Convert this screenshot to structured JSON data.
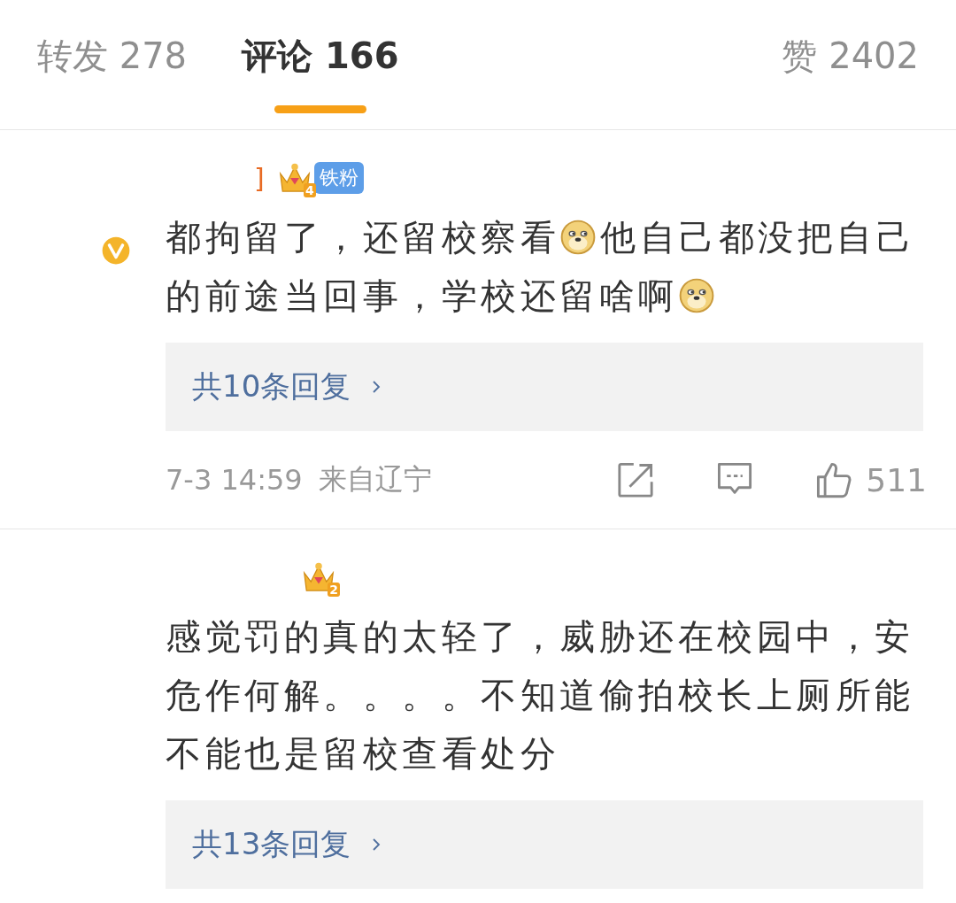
{
  "tabs": [
    {
      "label": "转发 278",
      "selected": false
    },
    {
      "label": "评论 166",
      "selected": true
    },
    {
      "label": "赞 2402",
      "selected": false
    }
  ],
  "comments": [
    {
      "name": "]",
      "verified": true,
      "crown_level": "4",
      "fan_badge": "铁粉",
      "lines": [
        [
          {
            "kind": "text",
            "text": "都拘留了，还留校察看"
          },
          {
            "kind": "emoji"
          },
          {
            "kind": "text",
            "text": "他自己都没把自己"
          }
        ],
        [
          {
            "kind": "text",
            "text": "的前途当回事，学校还留啥啊"
          },
          {
            "kind": "emoji"
          }
        ]
      ],
      "replies": "共10条回复",
      "time": "7-3 14:59",
      "location": "来自辽宁",
      "likes": "511"
    },
    {
      "verified": false,
      "crown_level": "2",
      "lines": [
        [
          {
            "kind": "text",
            "text": "感觉罚的真的太轻了，威胁还在校园中，安"
          }
        ],
        [
          {
            "kind": "text",
            "text": "危作何解。。。。不知道偷拍校长上厕所能"
          }
        ],
        [
          {
            "kind": "text",
            "text": "不能也是留校查看处分"
          }
        ]
      ],
      "replies": "共13条回复"
    }
  ]
}
